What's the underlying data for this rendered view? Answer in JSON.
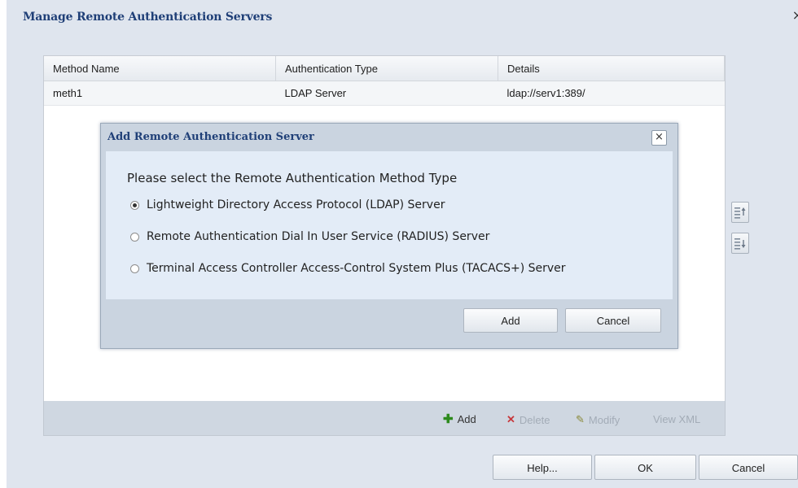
{
  "dialog": {
    "title": "Manage Remote Authentication Servers",
    "close_glyph": "×"
  },
  "table": {
    "columns": [
      "Method Name",
      "Authentication Type",
      "Details"
    ],
    "rows": [
      [
        "meth1",
        "LDAP Server",
        "ldap://serv1:389/"
      ]
    ]
  },
  "toolbar": {
    "add_label": "Add",
    "delete_label": "Delete",
    "modify_label": "Modify",
    "view_xml_label": "View XML"
  },
  "side_buttons": {
    "move_up_icon": "move-up-icon",
    "move_down_icon": "move-down-icon"
  },
  "footer": {
    "help_label": "Help...",
    "ok_label": "OK",
    "cancel_label": "Cancel"
  },
  "modal": {
    "title": "Add Remote Authentication Server",
    "close_glyph": "×",
    "prompt": "Please select the Remote Authentication Method Type",
    "options": [
      {
        "label": "Lightweight Directory Access Protocol (LDAP) Server",
        "checked": true
      },
      {
        "label": "Remote Authentication Dial In User Service (RADIUS) Server",
        "checked": false
      },
      {
        "label": "Terminal Access Controller Access-Control System Plus (TACACS+) Server",
        "checked": false
      }
    ],
    "add_label": "Add",
    "cancel_label": "Cancel"
  },
  "colors": {
    "title_blue": "#1f3f77",
    "panel_bg": "#dfe5ee",
    "modal_body_bg": "#e3ecf7"
  }
}
